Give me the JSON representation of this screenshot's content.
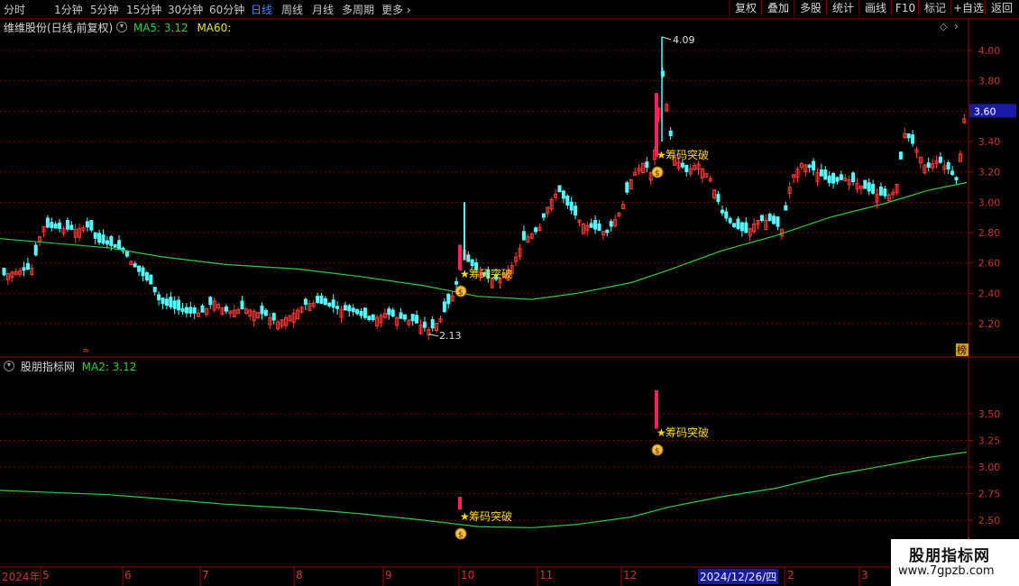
{
  "toolbar": {
    "periods": [
      "分时",
      "1分钟",
      "5分钟",
      "15分钟",
      "30分钟",
      "60分钟",
      "日线",
      "周线",
      "月线",
      "多周期",
      "更多"
    ],
    "active_period": "日线",
    "right_buttons": [
      "复权",
      "叠加",
      "多股",
      "统计",
      "画线",
      "F10",
      "标记",
      "+自选",
      "返回"
    ]
  },
  "main_panel": {
    "title": "维维股份(日线,前复权)",
    "ma5_label": "MA5: 3.12",
    "ma60_label": "MA60:",
    "price_tag": "3.60",
    "high_label": "4.09",
    "low_label": "2.13",
    "signal_text": "筹码突破",
    "rank_badge": "榜",
    "y_ticks": [
      "4.00",
      "3.80",
      "3.60",
      "3.40",
      "3.20",
      "3.00",
      "2.80",
      "2.60",
      "2.40",
      "2.20"
    ],
    "ma60_color": "#2ecc40",
    "up_color": "#ff3a3a",
    "down_color": "#54ffff"
  },
  "sub_panel": {
    "title": "股朋指标网",
    "ma2_label": "MA2: 3.12",
    "signal_text": "筹码突破",
    "y_ticks": [
      "3.50",
      "3.25",
      "3.00",
      "2.75",
      "2.50"
    ]
  },
  "x_axis": {
    "labels": [
      "2024年",
      "5",
      "6",
      "7",
      "8",
      "9",
      "10",
      "11",
      "12",
      "2024/12/26/四",
      "2",
      "3"
    ]
  },
  "watermark": {
    "line1": "股朋指标网",
    "line2": "www.7gpzb.com"
  }
}
